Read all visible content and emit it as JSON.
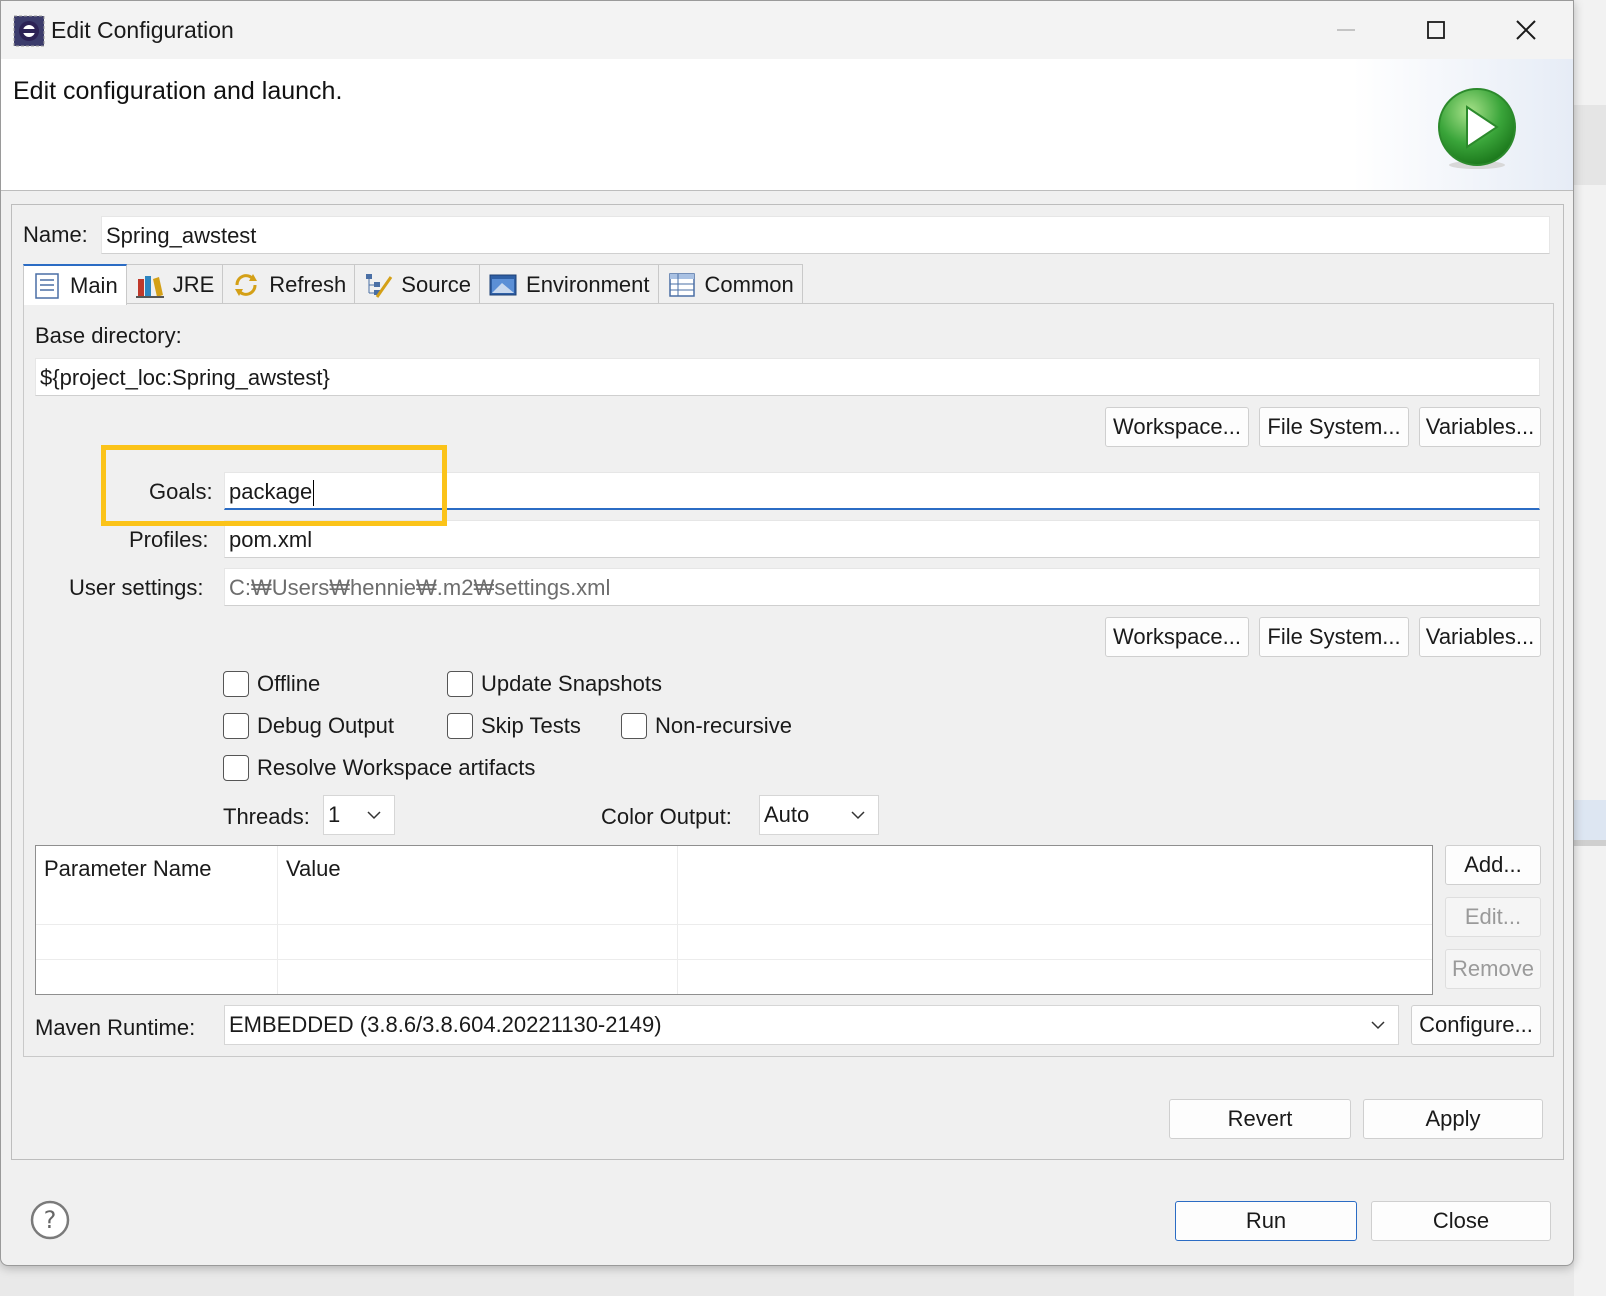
{
  "window": {
    "title": "Edit Configuration",
    "controls": {
      "minimize": "—",
      "maximize": "☐",
      "close": "✕"
    }
  },
  "banner": {
    "title": "Edit configuration and launch."
  },
  "config": {
    "name_label": "Name:",
    "name_value": "Spring_awstest"
  },
  "tabs": [
    {
      "label": "Main",
      "icon": "main-tab-icon",
      "active": true
    },
    {
      "label": "JRE",
      "icon": "jre-books-icon"
    },
    {
      "label": "Refresh",
      "icon": "refresh-icon"
    },
    {
      "label": "Source",
      "icon": "source-icon"
    },
    {
      "label": "Environment",
      "icon": "environment-icon"
    },
    {
      "label": "Common",
      "icon": "common-table-icon"
    }
  ],
  "main": {
    "base_directory_label": "Base directory:",
    "base_directory_value": "${project_loc:Spring_awstest}",
    "dir_buttons": {
      "workspace": "Workspace...",
      "file_system": "File System...",
      "variables": "Variables..."
    },
    "goals_label": "Goals:",
    "goals_value": "package",
    "profiles_label": "Profiles:",
    "profiles_value": "pom.xml",
    "user_settings_label": "User settings:",
    "user_settings_value": "C:₩Users₩hennie₩.m2₩settings.xml",
    "settings_buttons": {
      "workspace": "Workspace...",
      "file_system": "File System...",
      "variables": "Variables..."
    },
    "checkboxes": {
      "offline": {
        "label": "Offline",
        "checked": false
      },
      "update_snapshots": {
        "label": "Update Snapshots",
        "checked": false
      },
      "debug_output": {
        "label": "Debug Output",
        "checked": false
      },
      "skip_tests": {
        "label": "Skip Tests",
        "checked": false
      },
      "non_recursive": {
        "label": "Non-recursive",
        "checked": false
      },
      "resolve_workspace": {
        "label": "Resolve Workspace artifacts",
        "checked": false
      }
    },
    "threads_label": "Threads:",
    "threads_value": "1",
    "color_output_label": "Color Output:",
    "color_output_value": "Auto",
    "params_table": {
      "columns": [
        "Parameter Name",
        "Value"
      ],
      "rows": []
    },
    "param_buttons": {
      "add": "Add...",
      "edit": "Edit...",
      "remove": "Remove"
    },
    "maven_runtime_label": "Maven Runtime:",
    "maven_runtime_value": "EMBEDDED (3.8.6/3.8.604.20221130-2149)",
    "configure_button": "Configure..."
  },
  "footer": {
    "revert": "Revert",
    "apply": "Apply",
    "run": "Run",
    "close": "Close",
    "help_icon": "help-question-icon"
  },
  "colors": {
    "highlight": "#fbc319",
    "focus_accent": "#2b6cc4",
    "run_icon_green": "#3aa53a"
  }
}
